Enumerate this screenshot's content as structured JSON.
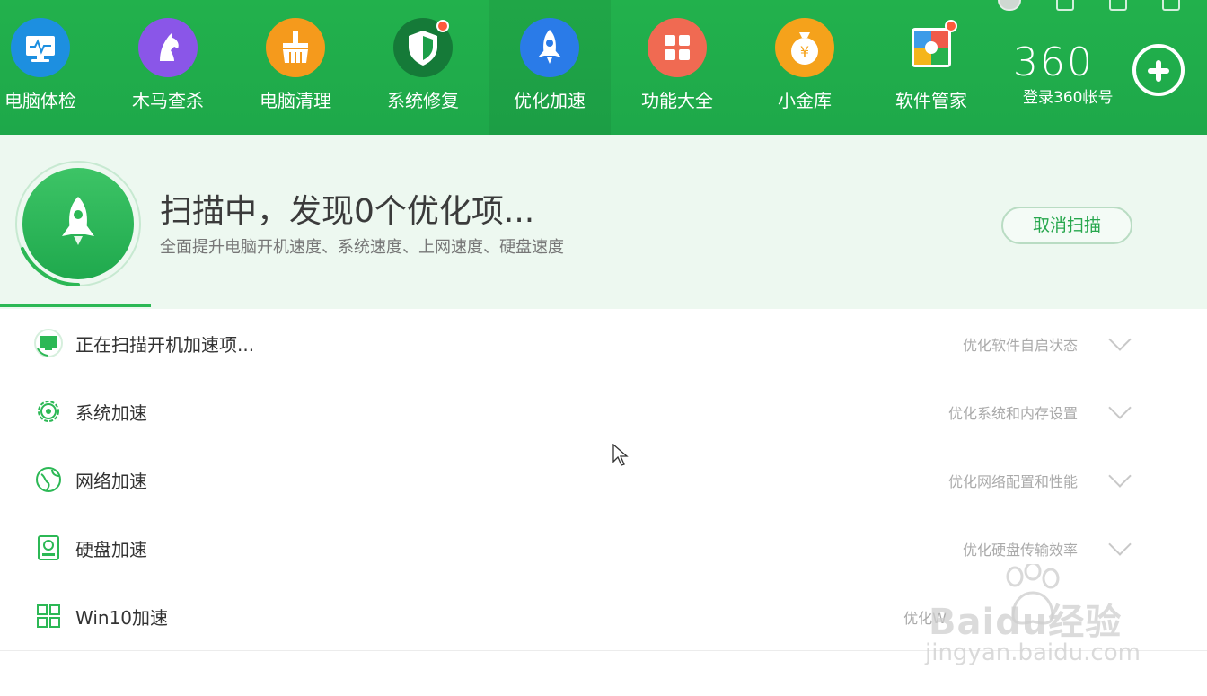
{
  "nav": {
    "items": [
      {
        "label": "电脑体检",
        "icon": "monitor-check-icon",
        "color": "#1d8fe0"
      },
      {
        "label": "木马查杀",
        "icon": "horse-icon",
        "color": "#8a56e8"
      },
      {
        "label": "电脑清理",
        "icon": "broom-icon",
        "color": "#f59a1c"
      },
      {
        "label": "系统修复",
        "icon": "shield-icon",
        "color": "#1c9e48"
      },
      {
        "label": "优化加速",
        "icon": "rocket-icon",
        "color": "#2a7be8"
      },
      {
        "label": "功能大全",
        "icon": "grid-icon",
        "color": "#f06a52"
      },
      {
        "label": "小金库",
        "icon": "money-bag-icon",
        "color": "#f5a21b"
      },
      {
        "label": "软件管家",
        "icon": "software-store-icon",
        "color": "#ffffff"
      }
    ],
    "active_index": 4,
    "brand": "360",
    "login_label": "登录360帐号"
  },
  "scan": {
    "title": "扫描中，发现0个优化项...",
    "subtitle": "全面提升电脑开机速度、系统速度、上网速度、硬盘速度",
    "cancel_label": "取消扫描",
    "progress_fraction": 0.125
  },
  "list": [
    {
      "label": "正在扫描开机加速项...",
      "desc": "优化软件自启状态",
      "icon": "boot-monitor-icon"
    },
    {
      "label": "系统加速",
      "desc": "优化系统和内存设置",
      "icon": "gear-icon"
    },
    {
      "label": "网络加速",
      "desc": "优化网络配置和性能",
      "icon": "globe-icon"
    },
    {
      "label": "硬盘加速",
      "desc": "优化硬盘传输效率",
      "icon": "hard-disk-icon"
    },
    {
      "label": "Win10加速",
      "desc": "优化W",
      "icon": "windows-icon"
    }
  ],
  "watermark": {
    "text": "Baidu经验",
    "url": "jingyan.baidu.com"
  },
  "colors": {
    "brand_green": "#22b14c",
    "banner_bg": "#edf8f0",
    "accent_text": "#27a74d"
  }
}
